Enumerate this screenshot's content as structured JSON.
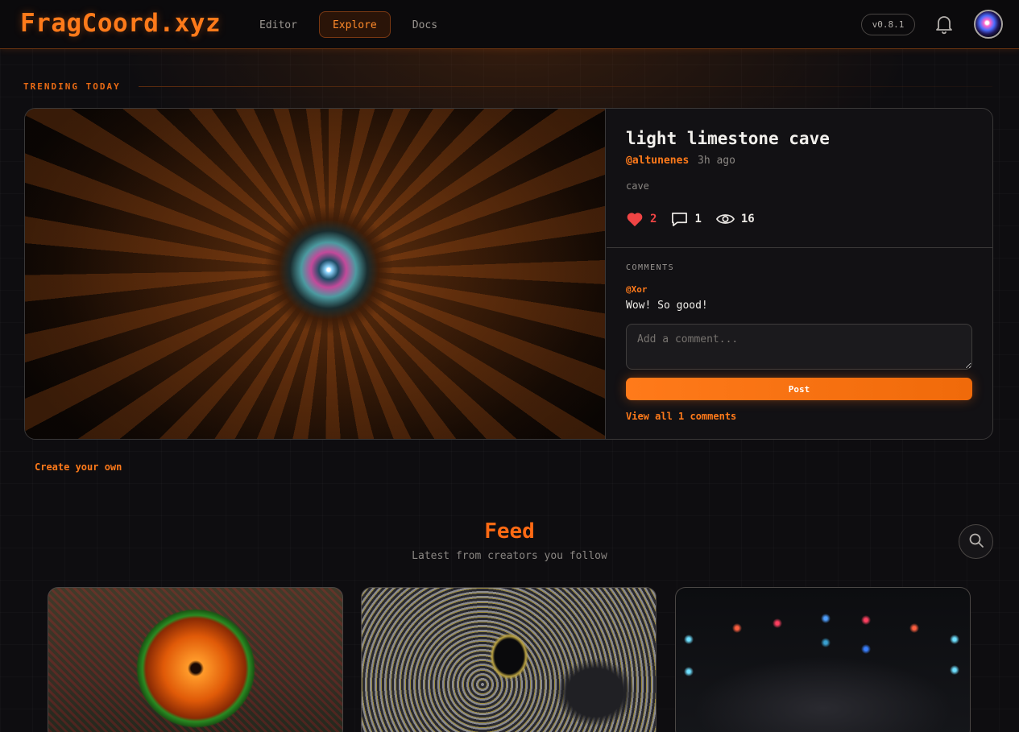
{
  "header": {
    "logo": "FragCoord.xyz",
    "nav": [
      {
        "label": "Editor",
        "active": false
      },
      {
        "label": "Explore",
        "active": true
      },
      {
        "label": "Docs",
        "active": false
      }
    ],
    "version": "v0.8.1",
    "icons": {
      "notifications": "bell-icon",
      "avatar": "user-avatar"
    }
  },
  "trending": {
    "section_label": "TRENDING TODAY",
    "title": "light limestone cave",
    "author": "@altunenes",
    "time_ago": "3h ago",
    "tag": "cave",
    "likes": "2",
    "comments_count": "1",
    "views": "16",
    "comments_heading": "COMMENTS",
    "comments": [
      {
        "user": "@Xor",
        "text": "Wow! So good!"
      }
    ],
    "comment_placeholder": "Add a comment...",
    "post_label": "Post",
    "view_all_label": "View all 1 comments"
  },
  "create_own_label": "Create your own",
  "feed": {
    "title": "Feed",
    "subtitle": "Latest from creators you follow"
  },
  "colors": {
    "accent": "#ff7a1a",
    "like": "#ef4444",
    "background": "#0e0d10",
    "card_border": "#3a3838"
  }
}
